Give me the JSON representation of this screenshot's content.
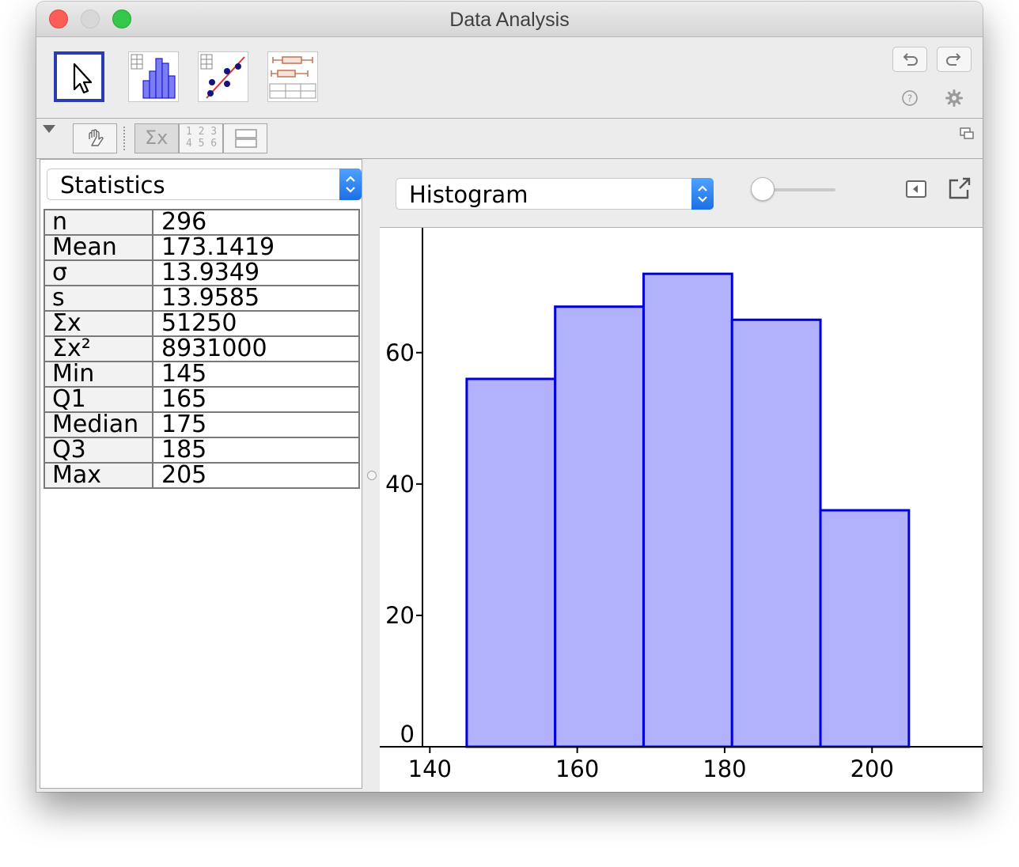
{
  "window": {
    "title": "Data Analysis"
  },
  "toolbar": {
    "tools": [
      {
        "name": "move-tool",
        "icon": "cursor-arrow-icon",
        "selected": true
      },
      {
        "name": "one-variable-analysis-tool",
        "icon": "histogram-table-icon",
        "selected": false
      },
      {
        "name": "two-variable-regression-tool",
        "icon": "scatter-regression-icon",
        "selected": false
      },
      {
        "name": "multiple-variable-analysis-tool",
        "icon": "boxplot-table-icon",
        "selected": false
      }
    ],
    "undo_icon": "undo-icon",
    "redo_icon": "redo-icon",
    "help_icon": "help-icon",
    "settings_icon": "gear-icon"
  },
  "subbar": {
    "toggle_icon": "triangle-down-icon",
    "buttons": [
      "hand-icon",
      "sigma-x-icon",
      "number-grid-icon",
      "split-panel-icon"
    ],
    "digits_top": "1 2 3",
    "digits_bottom": "4 5 6",
    "sigma_label": "Σx",
    "restore_icon": "restore-window-icon"
  },
  "left": {
    "select_value": "Statistics",
    "stats": [
      {
        "key": "n",
        "value": "296"
      },
      {
        "key": "Mean",
        "value": "173.1419"
      },
      {
        "key": "σ",
        "value": "13.9349"
      },
      {
        "key": "s",
        "value": "13.9585"
      },
      {
        "key": "Σx",
        "value": "51250"
      },
      {
        "key": "Σx²",
        "value": "8931000"
      },
      {
        "key": "Min",
        "value": "145"
      },
      {
        "key": "Q1",
        "value": "165"
      },
      {
        "key": "Median",
        "value": "175"
      },
      {
        "key": "Q3",
        "value": "185"
      },
      {
        "key": "Max",
        "value": "205"
      }
    ]
  },
  "right": {
    "select_value": "Histogram",
    "collapse_icon": "panel-collapse-icon",
    "export_icon": "export-window-icon"
  },
  "colors": {
    "bar_fill": "#b2b2fc",
    "bar_stroke": "#0000dd",
    "selected_tool": "#2b3bb0",
    "select_accent": "#1d6fe6"
  },
  "chart_data": {
    "type": "bar",
    "bins": [
      {
        "start": 145,
        "end": 157,
        "value": 56
      },
      {
        "start": 157,
        "end": 169,
        "value": 67
      },
      {
        "start": 169,
        "end": 181,
        "value": 72
      },
      {
        "start": 181,
        "end": 193,
        "value": 65
      },
      {
        "start": 193,
        "end": 205,
        "value": 36
      }
    ],
    "xlim": [
      139,
      215
    ],
    "ylim": [
      0,
      79
    ],
    "xticks": [
      140,
      160,
      180,
      200
    ],
    "yticks": [
      0,
      20,
      40,
      60
    ],
    "grid": false,
    "title": "",
    "xlabel": "",
    "ylabel": ""
  }
}
